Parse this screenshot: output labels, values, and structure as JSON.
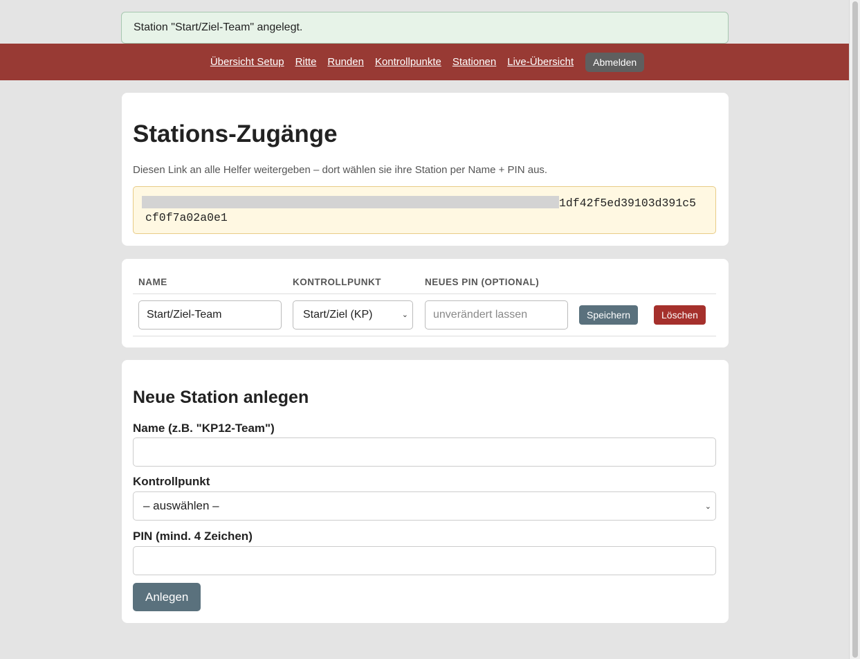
{
  "flash": {
    "message": "Station \"Start/Ziel-Team\" angelegt."
  },
  "nav": {
    "links": [
      "Übersicht Setup",
      "Ritte",
      "Runden",
      "Kontrollpunkte",
      "Stationen",
      "Live-Übersicht"
    ],
    "logout_label": "Abmelden"
  },
  "access": {
    "title": "Stations-Zugänge",
    "hint": "Diesen Link an alle Helfer weitergeben – dort wählen sie ihre Station per Name + PIN aus.",
    "link_visible_line1": "1df42f5ed39103d391c5",
    "link_visible_line2": "cf0f7a02a0e1"
  },
  "stations_table": {
    "headers": [
      "NAME",
      "KONTROLLPUNKT",
      "NEUES PIN (OPTIONAL)"
    ],
    "rows": [
      {
        "name": "Start/Ziel-Team",
        "kontrollpunkt": "Start/Ziel (KP)",
        "pin_placeholder": "unverändert lassen",
        "save_label": "Speichern",
        "delete_label": "Löschen"
      }
    ]
  },
  "new_station": {
    "title": "Neue Station anlegen",
    "name_label": "Name (z.B. \"KP12-Team\")",
    "name_value": "",
    "kp_label": "Kontrollpunkt",
    "kp_selected": "– auswählen –",
    "pin_label": "PIN (mind. 4 Zeichen)",
    "pin_value": "",
    "submit_label": "Anlegen"
  },
  "colors": {
    "nav_bg": "#983a34",
    "flash_bg": "#e7f3e8",
    "link_box_bg": "#fff8e2",
    "primary_button": "#5a717d",
    "danger_button": "#a5302c"
  }
}
